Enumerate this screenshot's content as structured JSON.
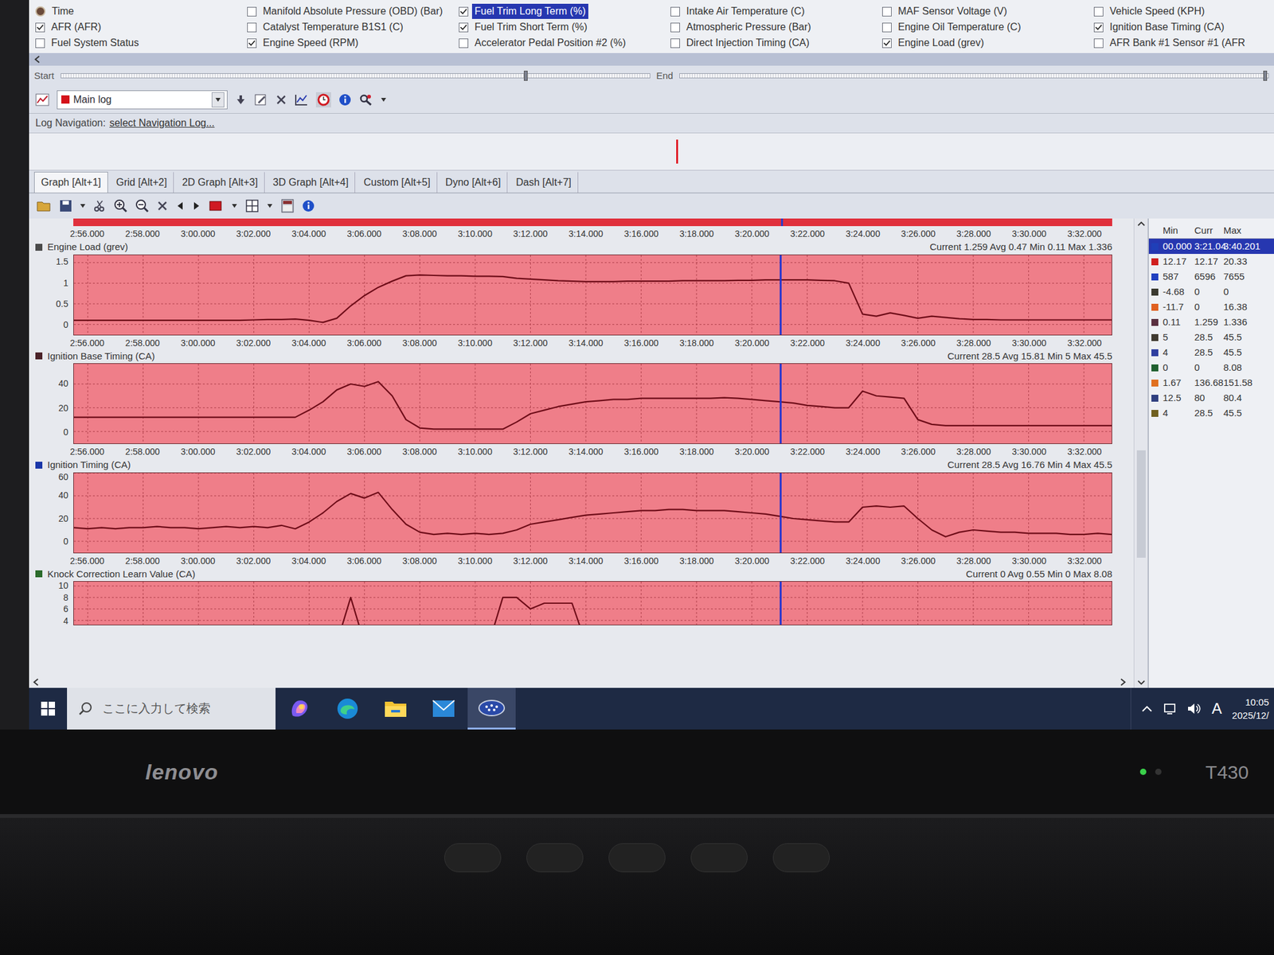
{
  "params": [
    {
      "label": "Time",
      "checked": true,
      "selected": false,
      "kind": "clock"
    },
    {
      "label": "AFR (AFR)",
      "checked": true,
      "selected": false,
      "kind": "checkbox"
    },
    {
      "label": "Fuel System Status",
      "checked": false,
      "selected": false,
      "kind": "checkbox"
    },
    {
      "label": "Manifold Absolute Pressure (OBD) (Bar)",
      "checked": false,
      "selected": false,
      "kind": "checkbox"
    },
    {
      "label": "Catalyst Temperature B1S1 (C)",
      "checked": false,
      "selected": false,
      "kind": "checkbox"
    },
    {
      "label": "Engine Speed (RPM)",
      "checked": true,
      "selected": false,
      "kind": "checkbox"
    },
    {
      "label": "Fuel Trim Long Term (%)",
      "checked": true,
      "selected": true,
      "kind": "checkbox"
    },
    {
      "label": "Fuel Trim Short Term (%)",
      "checked": true,
      "selected": false,
      "kind": "checkbox"
    },
    {
      "label": "Accelerator Pedal Position #2 (%)",
      "checked": false,
      "selected": false,
      "kind": "checkbox"
    },
    {
      "label": "Intake Air Temperature (C)",
      "checked": false,
      "selected": false,
      "kind": "checkbox"
    },
    {
      "label": "Atmospheric Pressure (Bar)",
      "checked": false,
      "selected": false,
      "kind": "checkbox"
    },
    {
      "label": "Direct Injection Timing (CA)",
      "checked": false,
      "selected": false,
      "kind": "checkbox"
    },
    {
      "label": "MAF Sensor Voltage (V)",
      "checked": false,
      "selected": false,
      "kind": "checkbox"
    },
    {
      "label": "Engine Oil Temperature (C)",
      "checked": false,
      "selected": false,
      "kind": "checkbox"
    },
    {
      "label": "Engine Load (grev)",
      "checked": true,
      "selected": false,
      "kind": "checkbox"
    },
    {
      "label": "Vehicle Speed (KPH)",
      "checked": false,
      "selected": false,
      "kind": "checkbox"
    },
    {
      "label": "Ignition Base Timing (CA)",
      "checked": true,
      "selected": false,
      "kind": "checkbox"
    },
    {
      "label": "AFR Bank #1 Sensor #1 (AFR",
      "checked": false,
      "selected": false,
      "kind": "checkbox"
    }
  ],
  "range": {
    "start": "Start",
    "end": "End",
    "start_level": 0.79,
    "end_level": 0.995
  },
  "toolbar": {
    "log": "Main log"
  },
  "log_nav": {
    "label": "Log Navigation:",
    "link": "select Navigation Log..."
  },
  "nav_strip": {
    "marker_level": 0.52
  },
  "tabs": [
    {
      "label": "Graph [Alt+1]",
      "selected": true
    },
    {
      "label": "Grid [Alt+2]",
      "selected": false
    },
    {
      "label": "2D Graph [Alt+3]",
      "selected": false
    },
    {
      "label": "3D Graph [Alt+4]",
      "selected": false
    },
    {
      "label": "Custom [Alt+5]",
      "selected": false
    },
    {
      "label": "Dyno [Alt+6]",
      "selected": false
    },
    {
      "label": "Dash [Alt+7]",
      "selected": false
    }
  ],
  "x_axis": {
    "min": 175.5,
    "max": 213,
    "step": 0.5,
    "ticks": [
      {
        "label": "2:56.000",
        "value": 176
      },
      {
        "label": "2:58.000",
        "value": 178
      },
      {
        "label": "3:00.000",
        "value": 180
      },
      {
        "label": "3:02.000",
        "value": 182
      },
      {
        "label": "3:04.000",
        "value": 184
      },
      {
        "label": "3:06.000",
        "value": 186
      },
      {
        "label": "3:08.000",
        "value": 188
      },
      {
        "label": "3:10.000",
        "value": 190
      },
      {
        "label": "3:12.000",
        "value": 192
      },
      {
        "label": "3:14.000",
        "value": 194
      },
      {
        "label": "3:16.000",
        "value": 196
      },
      {
        "label": "3:18.000",
        "value": 198
      },
      {
        "label": "3:20.000",
        "value": 200
      },
      {
        "label": "3:22.000",
        "value": 202
      },
      {
        "label": "3:24.000",
        "value": 204
      },
      {
        "label": "3:26.000",
        "value": 206
      },
      {
        "label": "3:28.000",
        "value": 208
      },
      {
        "label": "3:30.000",
        "value": 210
      },
      {
        "label": "3:32.000",
        "value": 212
      }
    ]
  },
  "cursor": {
    "value": 201.04
  },
  "charts": [
    {
      "title": "Engine Load (grev)",
      "color": "#4a4a4a",
      "stats": "Current 1.259 Avg 0.47 Min 0.11 Max 1.336",
      "y_min": -0.25,
      "y_max": 1.68,
      "y_ticks": [
        {
          "label": "1.5",
          "value": 1.5
        },
        {
          "label": "1",
          "value": 1
        },
        {
          "label": "0.5",
          "value": 0.5
        },
        {
          "label": "0",
          "value": 0
        }
      ],
      "values": [
        0.1,
        0.1,
        0.1,
        0.1,
        0.1,
        0.1,
        0.1,
        0.1,
        0.1,
        0.1,
        0.1,
        0.1,
        0.1,
        0.11,
        0.12,
        0.12,
        0.13,
        0.1,
        0.05,
        0.15,
        0.45,
        0.7,
        0.9,
        1.05,
        1.18,
        1.2,
        1.19,
        1.18,
        1.18,
        1.17,
        1.17,
        1.16,
        1.12,
        1.1,
        1.08,
        1.06,
        1.05,
        1.04,
        1.04,
        1.04,
        1.05,
        1.05,
        1.05,
        1.05,
        1.06,
        1.06,
        1.06,
        1.06,
        1.07,
        1.07,
        1.08,
        1.08,
        1.08,
        1.08,
        1.07,
        1.06,
        1.0,
        0.25,
        0.2,
        0.28,
        0.22,
        0.15,
        0.2,
        0.17,
        0.14,
        0.12,
        0.12,
        0.11,
        0.11,
        0.11,
        0.11,
        0.11,
        0.11,
        0.11,
        0.11,
        0.11
      ]
    },
    {
      "title": "Ignition Base Timing (CA)",
      "color": "#4a2228",
      "stats": "Current 28.5 Avg 15.81 Min 5 Max 45.5",
      "y_min": -10,
      "y_max": 57,
      "y_ticks": [
        {
          "label": "40",
          "value": 40
        },
        {
          "label": "20",
          "value": 20
        },
        {
          "label": "0",
          "value": 0
        }
      ],
      "values": [
        12,
        12,
        12,
        12,
        12,
        12,
        12,
        12,
        12,
        12,
        12,
        12,
        12,
        12,
        12,
        12,
        12,
        18,
        25,
        35,
        40,
        38,
        42,
        30,
        10,
        3,
        2,
        2,
        2,
        2,
        2,
        2,
        8,
        15,
        18,
        21,
        23,
        25,
        26,
        27,
        27,
        28,
        28,
        28,
        28,
        28,
        28,
        28.5,
        28,
        27,
        26,
        25,
        24,
        22,
        21,
        20,
        20,
        34,
        30,
        29,
        28,
        10,
        6,
        5,
        5,
        5,
        5,
        5,
        5,
        5,
        5,
        5,
        5,
        5,
        5,
        5
      ]
    },
    {
      "title": "Ignition Timing (CA)",
      "color": "#1a36a8",
      "stats": "Current 28.5 Avg 16.76 Min 4 Max 45.5",
      "y_min": -10,
      "y_max": 60,
      "y_ticks": [
        {
          "label": "60",
          "value": 60
        },
        {
          "label": "40",
          "value": 40
        },
        {
          "label": "20",
          "value": 20
        },
        {
          "label": "0",
          "value": 0
        }
      ],
      "values": [
        12,
        11,
        12,
        11,
        12,
        12,
        13,
        12,
        12,
        11,
        12,
        13,
        12,
        13,
        12,
        14,
        11,
        17,
        25,
        35,
        42,
        38,
        43,
        28,
        15,
        8,
        6,
        7,
        6,
        7,
        6,
        7,
        10,
        15,
        17,
        19,
        21,
        23,
        24,
        25,
        26,
        27,
        27,
        28,
        28,
        27,
        27,
        27,
        26,
        25,
        24,
        22,
        20,
        19,
        18,
        17,
        17,
        30,
        31,
        30,
        31,
        20,
        10,
        4,
        8,
        10,
        9,
        8,
        8,
        7,
        7,
        7,
        6,
        6,
        7,
        6
      ]
    },
    {
      "title": "Knock Correction Learn Value (CA)",
      "color": "#2a6a2a",
      "stats": "Current 0 Avg 0.55 Min 0 Max 8.08",
      "y_min": 3.25,
      "y_max": 10.75,
      "y_ticks": [
        {
          "label": "10",
          "value": 10
        },
        {
          "label": "8",
          "value": 8
        },
        {
          "label": "6",
          "value": 6
        },
        {
          "label": "4",
          "value": 4
        }
      ],
      "values": [
        0,
        0,
        0,
        0,
        0,
        0,
        0,
        0,
        0,
        0,
        0,
        0,
        0,
        0,
        0,
        0,
        0,
        0,
        0,
        0,
        8,
        0,
        0,
        0,
        0,
        0,
        0,
        0,
        0,
        0,
        0,
        8,
        8,
        6,
        7,
        7,
        7,
        0,
        0,
        0,
        0,
        0,
        0,
        0,
        0,
        0,
        0,
        0,
        0,
        0,
        0,
        0,
        0,
        0,
        0,
        0,
        0,
        0,
        0,
        0,
        0,
        0,
        0,
        0,
        0,
        0,
        0,
        0,
        0,
        0,
        0,
        0,
        0,
        0,
        0,
        0
      ]
    }
  ],
  "stats_table": {
    "columns": [
      "Min",
      "Curr",
      "Max"
    ],
    "rows": [
      {
        "color": "#1f3fb8",
        "min": "00.000",
        "curr": "3:21.04",
        "max": "3:40.201",
        "selected": true
      },
      {
        "color": "#d02020",
        "min": "12.17",
        "curr": "12.17",
        "max": "20.33",
        "selected": false
      },
      {
        "color": "#2040c0",
        "min": "587",
        "curr": "6596",
        "max": "7655",
        "selected": false
      },
      {
        "color": "#3a3a30",
        "min": "-4.68",
        "curr": "0",
        "max": "0",
        "selected": false
      },
      {
        "color": "#e06020",
        "min": "-11.7",
        "curr": "0",
        "max": "16.38",
        "selected": false
      },
      {
        "color": "#5a3040",
        "min": "0.11",
        "curr": "1.259",
        "max": "1.336",
        "selected": false
      },
      {
        "color": "#403a30",
        "min": "5",
        "curr": "28.5",
        "max": "45.5",
        "selected": false
      },
      {
        "color": "#3040a0",
        "min": "4",
        "curr": "28.5",
        "max": "45.5",
        "selected": false
      },
      {
        "color": "#206030",
        "min": "0",
        "curr": "0",
        "max": "8.08",
        "selected": false
      },
      {
        "color": "#e07020",
        "min": "1.67",
        "curr": "136.68",
        "max": "151.58",
        "selected": false
      },
      {
        "color": "#304080",
        "min": "12.5",
        "curr": "80",
        "max": "80.4",
        "selected": false
      },
      {
        "color": "#706020",
        "min": "4",
        "curr": "28.5",
        "max": "45.5",
        "selected": false
      }
    ]
  },
  "taskbar": {
    "search_placeholder": "ここに入力して検索",
    "ime": "A",
    "time": "10:05",
    "date": "2025/12/"
  },
  "laptop": {
    "brand": "lenovo",
    "model": "T430"
  }
}
